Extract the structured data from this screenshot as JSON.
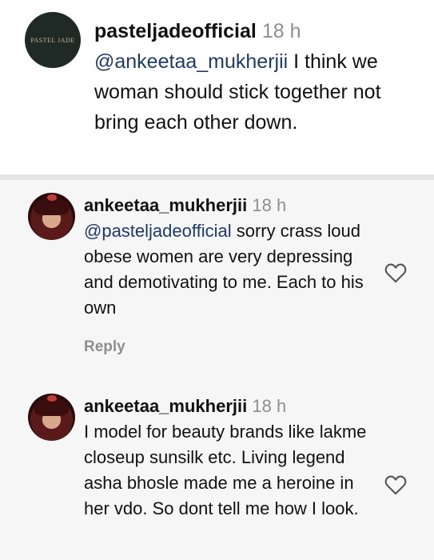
{
  "top_comment": {
    "avatar_logo_text": "PASTEL JADE",
    "username": "pasteljadeofficial",
    "time": "18 h",
    "mention": "@ankeetaa_mukherjii",
    "text": " I think we woman should stick together not bring each other down."
  },
  "replies": [
    {
      "username": "ankeetaa_mukherjii",
      "time": "18 h",
      "mention": "@pasteljadeofficial",
      "text": " sorry crass loud obese women are very depressing and demotivating to me. Each to his own",
      "reply_label": "Reply",
      "like_icon": "heart-outline"
    },
    {
      "username": "ankeetaa_mukherjii",
      "time": "18 h",
      "mention": "",
      "text": "I model for beauty brands like lakme closeup sunsilk etc. Living legend asha bhosle made me a heroine in her vdo. So dont tell me how I look.",
      "like_icon": "heart-outline"
    }
  ],
  "colors": {
    "mention": "#1e3a6b",
    "muted": "#8e8e8e",
    "panel_bg": "#f6f6f6"
  }
}
